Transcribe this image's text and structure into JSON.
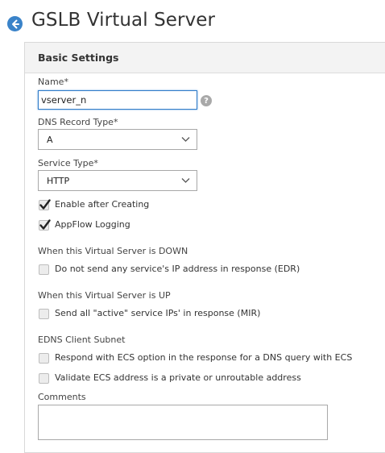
{
  "header": {
    "title": "GSLB Virtual Server"
  },
  "panel": {
    "title": "Basic Settings"
  },
  "fields": {
    "name": {
      "label": "Name*",
      "value": "vserver_n"
    },
    "dns_record_type": {
      "label": "DNS Record Type*",
      "value": "A"
    },
    "service_type": {
      "label": "Service Type*",
      "value": "HTTP"
    },
    "comments": {
      "label": "Comments",
      "value": ""
    }
  },
  "checkboxes": {
    "enable_after_creating": {
      "label": "Enable after Creating",
      "checked": true
    },
    "appflow_logging": {
      "label": "AppFlow Logging",
      "checked": true
    },
    "edr": {
      "label": "Do not send any service's IP address in response (EDR)",
      "checked": false
    },
    "mir": {
      "label": "Send all \"active\" service IPs' in response (MIR)",
      "checked": false
    },
    "ecs_respond": {
      "label": "Respond with ECS option in the response for a DNS query with ECS",
      "checked": false
    },
    "ecs_validate": {
      "label": "Validate ECS address is a private or unroutable address",
      "checked": false
    }
  },
  "sections": {
    "down": "When this Virtual Server is DOWN",
    "up": "When this Virtual Server is UP",
    "edns": "EDNS Client Subnet"
  },
  "icons": {
    "back": "back-arrow-icon",
    "help": "help-icon",
    "chevron": "chevron-down-icon",
    "check": "checkmark-icon"
  },
  "colors": {
    "accent": "#3a83c9",
    "focus": "#2f7bc8",
    "panel_header_bg": "#f3f3f3"
  }
}
